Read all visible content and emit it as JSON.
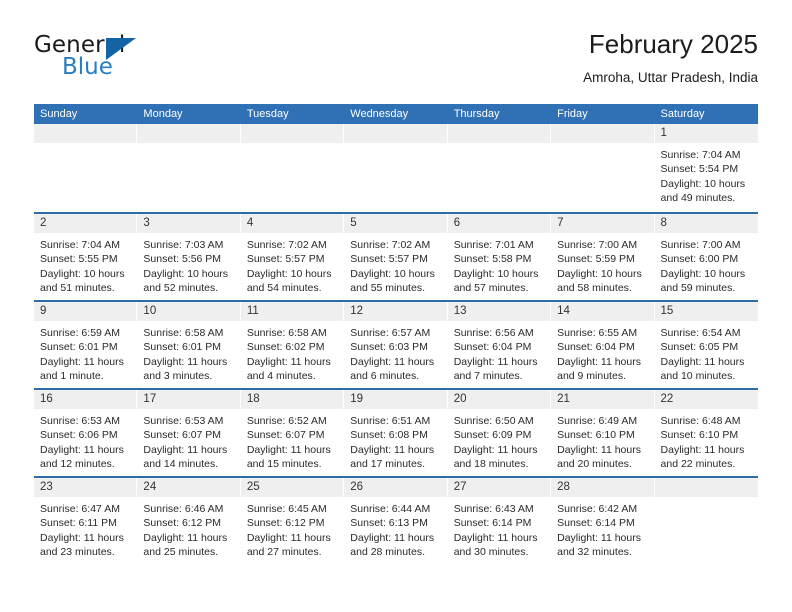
{
  "brand": {
    "name_top": "General",
    "name_bottom": "Blue",
    "color_dark": "#1a1a1a",
    "color_blue": "#2b7dc1",
    "triangle_color": "#1464a5"
  },
  "header": {
    "title": "February 2025",
    "subtitle": "Amroha, Uttar Pradesh, India"
  },
  "theme": {
    "header_row_bg": "#3070b4",
    "header_row_text": "#ffffff",
    "week_separator": "#2e6da7",
    "daynum_bg": "#efefef",
    "cell_bg": "#ffffff"
  },
  "calendar": {
    "weekday_headers": [
      "Sunday",
      "Monday",
      "Tuesday",
      "Wednesday",
      "Thursday",
      "Friday",
      "Saturday"
    ],
    "weeks": [
      [
        {
          "day": "",
          "empty": true
        },
        {
          "day": "",
          "empty": true
        },
        {
          "day": "",
          "empty": true
        },
        {
          "day": "",
          "empty": true
        },
        {
          "day": "",
          "empty": true
        },
        {
          "day": "",
          "empty": true
        },
        {
          "day": "1",
          "sunrise": "Sunrise: 7:04 AM",
          "sunset": "Sunset: 5:54 PM",
          "daylight": "Daylight: 10 hours and 49 minutes."
        }
      ],
      [
        {
          "day": "2",
          "sunrise": "Sunrise: 7:04 AM",
          "sunset": "Sunset: 5:55 PM",
          "daylight": "Daylight: 10 hours and 51 minutes."
        },
        {
          "day": "3",
          "sunrise": "Sunrise: 7:03 AM",
          "sunset": "Sunset: 5:56 PM",
          "daylight": "Daylight: 10 hours and 52 minutes."
        },
        {
          "day": "4",
          "sunrise": "Sunrise: 7:02 AM",
          "sunset": "Sunset: 5:57 PM",
          "daylight": "Daylight: 10 hours and 54 minutes."
        },
        {
          "day": "5",
          "sunrise": "Sunrise: 7:02 AM",
          "sunset": "Sunset: 5:57 PM",
          "daylight": "Daylight: 10 hours and 55 minutes."
        },
        {
          "day": "6",
          "sunrise": "Sunrise: 7:01 AM",
          "sunset": "Sunset: 5:58 PM",
          "daylight": "Daylight: 10 hours and 57 minutes."
        },
        {
          "day": "7",
          "sunrise": "Sunrise: 7:00 AM",
          "sunset": "Sunset: 5:59 PM",
          "daylight": "Daylight: 10 hours and 58 minutes."
        },
        {
          "day": "8",
          "sunrise": "Sunrise: 7:00 AM",
          "sunset": "Sunset: 6:00 PM",
          "daylight": "Daylight: 10 hours and 59 minutes."
        }
      ],
      [
        {
          "day": "9",
          "sunrise": "Sunrise: 6:59 AM",
          "sunset": "Sunset: 6:01 PM",
          "daylight": "Daylight: 11 hours and 1 minute."
        },
        {
          "day": "10",
          "sunrise": "Sunrise: 6:58 AM",
          "sunset": "Sunset: 6:01 PM",
          "daylight": "Daylight: 11 hours and 3 minutes."
        },
        {
          "day": "11",
          "sunrise": "Sunrise: 6:58 AM",
          "sunset": "Sunset: 6:02 PM",
          "daylight": "Daylight: 11 hours and 4 minutes."
        },
        {
          "day": "12",
          "sunrise": "Sunrise: 6:57 AM",
          "sunset": "Sunset: 6:03 PM",
          "daylight": "Daylight: 11 hours and 6 minutes."
        },
        {
          "day": "13",
          "sunrise": "Sunrise: 6:56 AM",
          "sunset": "Sunset: 6:04 PM",
          "daylight": "Daylight: 11 hours and 7 minutes."
        },
        {
          "day": "14",
          "sunrise": "Sunrise: 6:55 AM",
          "sunset": "Sunset: 6:04 PM",
          "daylight": "Daylight: 11 hours and 9 minutes."
        },
        {
          "day": "15",
          "sunrise": "Sunrise: 6:54 AM",
          "sunset": "Sunset: 6:05 PM",
          "daylight": "Daylight: 11 hours and 10 minutes."
        }
      ],
      [
        {
          "day": "16",
          "sunrise": "Sunrise: 6:53 AM",
          "sunset": "Sunset: 6:06 PM",
          "daylight": "Daylight: 11 hours and 12 minutes."
        },
        {
          "day": "17",
          "sunrise": "Sunrise: 6:53 AM",
          "sunset": "Sunset: 6:07 PM",
          "daylight": "Daylight: 11 hours and 14 minutes."
        },
        {
          "day": "18",
          "sunrise": "Sunrise: 6:52 AM",
          "sunset": "Sunset: 6:07 PM",
          "daylight": "Daylight: 11 hours and 15 minutes."
        },
        {
          "day": "19",
          "sunrise": "Sunrise: 6:51 AM",
          "sunset": "Sunset: 6:08 PM",
          "daylight": "Daylight: 11 hours and 17 minutes."
        },
        {
          "day": "20",
          "sunrise": "Sunrise: 6:50 AM",
          "sunset": "Sunset: 6:09 PM",
          "daylight": "Daylight: 11 hours and 18 minutes."
        },
        {
          "day": "21",
          "sunrise": "Sunrise: 6:49 AM",
          "sunset": "Sunset: 6:10 PM",
          "daylight": "Daylight: 11 hours and 20 minutes."
        },
        {
          "day": "22",
          "sunrise": "Sunrise: 6:48 AM",
          "sunset": "Sunset: 6:10 PM",
          "daylight": "Daylight: 11 hours and 22 minutes."
        }
      ],
      [
        {
          "day": "23",
          "sunrise": "Sunrise: 6:47 AM",
          "sunset": "Sunset: 6:11 PM",
          "daylight": "Daylight: 11 hours and 23 minutes."
        },
        {
          "day": "24",
          "sunrise": "Sunrise: 6:46 AM",
          "sunset": "Sunset: 6:12 PM",
          "daylight": "Daylight: 11 hours and 25 minutes."
        },
        {
          "day": "25",
          "sunrise": "Sunrise: 6:45 AM",
          "sunset": "Sunset: 6:12 PM",
          "daylight": "Daylight: 11 hours and 27 minutes."
        },
        {
          "day": "26",
          "sunrise": "Sunrise: 6:44 AM",
          "sunset": "Sunset: 6:13 PM",
          "daylight": "Daylight: 11 hours and 28 minutes."
        },
        {
          "day": "27",
          "sunrise": "Sunrise: 6:43 AM",
          "sunset": "Sunset: 6:14 PM",
          "daylight": "Daylight: 11 hours and 30 minutes."
        },
        {
          "day": "28",
          "sunrise": "Sunrise: 6:42 AM",
          "sunset": "Sunset: 6:14 PM",
          "daylight": "Daylight: 11 hours and 32 minutes."
        },
        {
          "day": "",
          "empty": true
        }
      ]
    ]
  }
}
